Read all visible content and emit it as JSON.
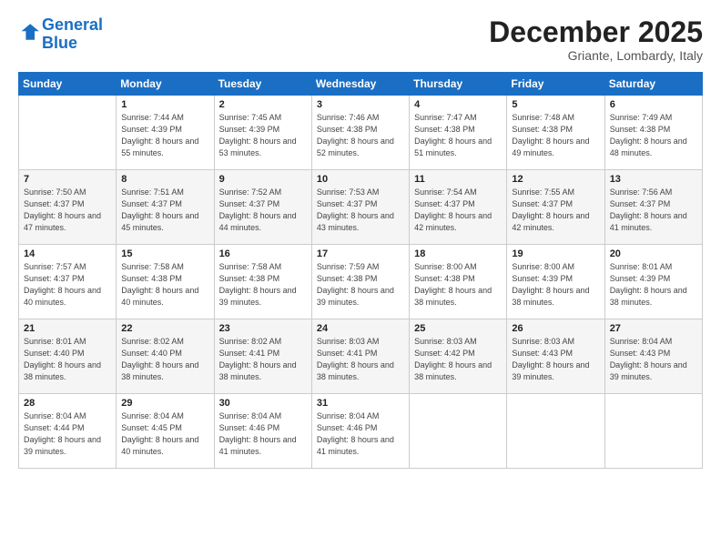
{
  "header": {
    "logo_line1": "General",
    "logo_line2": "Blue",
    "month": "December 2025",
    "location": "Griante, Lombardy, Italy"
  },
  "weekdays": [
    "Sunday",
    "Monday",
    "Tuesday",
    "Wednesday",
    "Thursday",
    "Friday",
    "Saturday"
  ],
  "weeks": [
    [
      {
        "day": "",
        "sunrise": "",
        "sunset": "",
        "daylight": ""
      },
      {
        "day": "1",
        "sunrise": "7:44 AM",
        "sunset": "4:39 PM",
        "daylight": "8 hours and 55 minutes."
      },
      {
        "day": "2",
        "sunrise": "7:45 AM",
        "sunset": "4:39 PM",
        "daylight": "8 hours and 53 minutes."
      },
      {
        "day": "3",
        "sunrise": "7:46 AM",
        "sunset": "4:38 PM",
        "daylight": "8 hours and 52 minutes."
      },
      {
        "day": "4",
        "sunrise": "7:47 AM",
        "sunset": "4:38 PM",
        "daylight": "8 hours and 51 minutes."
      },
      {
        "day": "5",
        "sunrise": "7:48 AM",
        "sunset": "4:38 PM",
        "daylight": "8 hours and 49 minutes."
      },
      {
        "day": "6",
        "sunrise": "7:49 AM",
        "sunset": "4:38 PM",
        "daylight": "8 hours and 48 minutes."
      }
    ],
    [
      {
        "day": "7",
        "sunrise": "7:50 AM",
        "sunset": "4:37 PM",
        "daylight": "8 hours and 47 minutes."
      },
      {
        "day": "8",
        "sunrise": "7:51 AM",
        "sunset": "4:37 PM",
        "daylight": "8 hours and 45 minutes."
      },
      {
        "day": "9",
        "sunrise": "7:52 AM",
        "sunset": "4:37 PM",
        "daylight": "8 hours and 44 minutes."
      },
      {
        "day": "10",
        "sunrise": "7:53 AM",
        "sunset": "4:37 PM",
        "daylight": "8 hours and 43 minutes."
      },
      {
        "day": "11",
        "sunrise": "7:54 AM",
        "sunset": "4:37 PM",
        "daylight": "8 hours and 42 minutes."
      },
      {
        "day": "12",
        "sunrise": "7:55 AM",
        "sunset": "4:37 PM",
        "daylight": "8 hours and 42 minutes."
      },
      {
        "day": "13",
        "sunrise": "7:56 AM",
        "sunset": "4:37 PM",
        "daylight": "8 hours and 41 minutes."
      }
    ],
    [
      {
        "day": "14",
        "sunrise": "7:57 AM",
        "sunset": "4:37 PM",
        "daylight": "8 hours and 40 minutes."
      },
      {
        "day": "15",
        "sunrise": "7:58 AM",
        "sunset": "4:38 PM",
        "daylight": "8 hours and 40 minutes."
      },
      {
        "day": "16",
        "sunrise": "7:58 AM",
        "sunset": "4:38 PM",
        "daylight": "8 hours and 39 minutes."
      },
      {
        "day": "17",
        "sunrise": "7:59 AM",
        "sunset": "4:38 PM",
        "daylight": "8 hours and 39 minutes."
      },
      {
        "day": "18",
        "sunrise": "8:00 AM",
        "sunset": "4:38 PM",
        "daylight": "8 hours and 38 minutes."
      },
      {
        "day": "19",
        "sunrise": "8:00 AM",
        "sunset": "4:39 PM",
        "daylight": "8 hours and 38 minutes."
      },
      {
        "day": "20",
        "sunrise": "8:01 AM",
        "sunset": "4:39 PM",
        "daylight": "8 hours and 38 minutes."
      }
    ],
    [
      {
        "day": "21",
        "sunrise": "8:01 AM",
        "sunset": "4:40 PM",
        "daylight": "8 hours and 38 minutes."
      },
      {
        "day": "22",
        "sunrise": "8:02 AM",
        "sunset": "4:40 PM",
        "daylight": "8 hours and 38 minutes."
      },
      {
        "day": "23",
        "sunrise": "8:02 AM",
        "sunset": "4:41 PM",
        "daylight": "8 hours and 38 minutes."
      },
      {
        "day": "24",
        "sunrise": "8:03 AM",
        "sunset": "4:41 PM",
        "daylight": "8 hours and 38 minutes."
      },
      {
        "day": "25",
        "sunrise": "8:03 AM",
        "sunset": "4:42 PM",
        "daylight": "8 hours and 38 minutes."
      },
      {
        "day": "26",
        "sunrise": "8:03 AM",
        "sunset": "4:43 PM",
        "daylight": "8 hours and 39 minutes."
      },
      {
        "day": "27",
        "sunrise": "8:04 AM",
        "sunset": "4:43 PM",
        "daylight": "8 hours and 39 minutes."
      }
    ],
    [
      {
        "day": "28",
        "sunrise": "8:04 AM",
        "sunset": "4:44 PM",
        "daylight": "8 hours and 39 minutes."
      },
      {
        "day": "29",
        "sunrise": "8:04 AM",
        "sunset": "4:45 PM",
        "daylight": "8 hours and 40 minutes."
      },
      {
        "day": "30",
        "sunrise": "8:04 AM",
        "sunset": "4:46 PM",
        "daylight": "8 hours and 41 minutes."
      },
      {
        "day": "31",
        "sunrise": "8:04 AM",
        "sunset": "4:46 PM",
        "daylight": "8 hours and 41 minutes."
      },
      {
        "day": "",
        "sunrise": "",
        "sunset": "",
        "daylight": ""
      },
      {
        "day": "",
        "sunrise": "",
        "sunset": "",
        "daylight": ""
      },
      {
        "day": "",
        "sunrise": "",
        "sunset": "",
        "daylight": ""
      }
    ]
  ]
}
